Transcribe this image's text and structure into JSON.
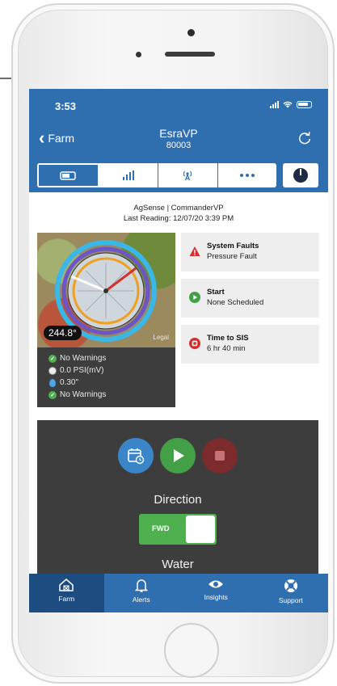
{
  "status_bar": {
    "time": "3:53"
  },
  "nav": {
    "back_label": "Farm",
    "title": "EsraVP",
    "subtitle": "80003"
  },
  "tabs": [
    {
      "icon": "toggle-icon",
      "active": true
    },
    {
      "icon": "bar-chart-icon",
      "active": false
    },
    {
      "icon": "antenna-icon",
      "active": false
    },
    {
      "icon": "more-dots-icon",
      "active": false
    }
  ],
  "header": {
    "device": "AgSense | CommanderVP",
    "last_reading": "Last Reading: 12/07/20 3:39 PM"
  },
  "map": {
    "heading": "244.8°",
    "legal": "Legal",
    "status": [
      {
        "icon": "check-icon",
        "text": "No Warnings"
      },
      {
        "icon": "pressure-gauge-icon",
        "text": "0.0 PSI(mV)"
      },
      {
        "icon": "water-drop-icon",
        "text": "0.30\""
      },
      {
        "icon": "check-icon",
        "text": "No Warnings"
      }
    ]
  },
  "info_cards": [
    {
      "icon": "warning-triangle-icon",
      "title": "System Faults",
      "subtitle": "Pressure Fault",
      "color": "#d32f2f"
    },
    {
      "icon": "play-circle-icon",
      "title": "Start",
      "subtitle": "None Scheduled",
      "color": "#43a047"
    },
    {
      "icon": "stop-circle-icon",
      "title": "Time to SIS",
      "subtitle": "6 hr 40 min",
      "color": "#d32f2f"
    }
  ],
  "controls": {
    "direction_label": "Direction",
    "direction_value": "FWD",
    "water_label": "Water"
  },
  "bottom_nav": [
    {
      "label": "Farm",
      "icon": "farm-barn-icon",
      "active": true
    },
    {
      "label": "Alerts",
      "icon": "bell-icon",
      "active": false
    },
    {
      "label": "Insights",
      "icon": "eye-icon",
      "active": false
    },
    {
      "label": "Support",
      "icon": "lifebuoy-icon",
      "active": false
    }
  ],
  "colors": {
    "primary": "#2f6fb0",
    "card_dark": "#3d3d3d",
    "green": "#4fb04f",
    "red": "#d32f2f"
  }
}
